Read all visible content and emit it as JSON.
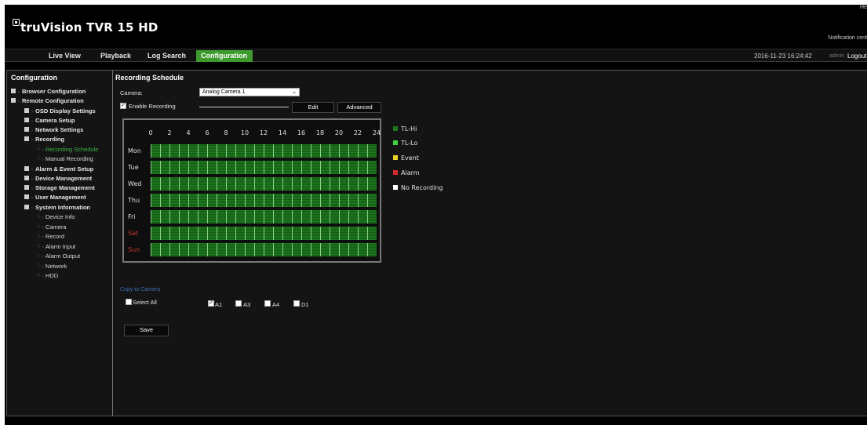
{
  "header": {
    "brand": "truVision TVR 15 HD",
    "top_right": "He",
    "notification": "Notification cent"
  },
  "nav": {
    "tabs": [
      {
        "label": "Live View",
        "active": false
      },
      {
        "label": "Playback",
        "active": false
      },
      {
        "label": "Log Search",
        "active": false
      },
      {
        "label": "Configuration",
        "active": true
      }
    ],
    "datetime": "2016-11-23 16:24:42",
    "user": "admin",
    "logout": "Logout"
  },
  "sidebar": {
    "title": "Configuration",
    "items": [
      {
        "label": "Browser Configuration"
      },
      {
        "label": "Remote Configuration"
      },
      {
        "label": "OSD Display Settings"
      },
      {
        "label": "Camera Setup"
      },
      {
        "label": "Network Settings"
      },
      {
        "label": "Recording"
      },
      {
        "label": "Recording Schedule",
        "selected": true
      },
      {
        "label": "Manual Recording"
      },
      {
        "label": "Alarm & Event Setup"
      },
      {
        "label": "Device Management"
      },
      {
        "label": "Storage Management"
      },
      {
        "label": "User Management"
      },
      {
        "label": "System Information"
      },
      {
        "label": "Device Info"
      },
      {
        "label": "Camera"
      },
      {
        "label": "Record"
      },
      {
        "label": "Alarm Input"
      },
      {
        "label": "Alarm Output"
      },
      {
        "label": "Network"
      },
      {
        "label": "HDD"
      }
    ]
  },
  "main": {
    "title": "Recording Schedule",
    "camera_label": "Camera:",
    "camera_value": "Analog Camera 1",
    "enable_recording_label": "Enable Recording",
    "enable_recording_checked": true,
    "edit_button": "Edit",
    "advanced_button": "Advanced",
    "hours": [
      "0",
      "2",
      "4",
      "6",
      "8",
      "10",
      "12",
      "14",
      "16",
      "18",
      "20",
      "22",
      "24"
    ],
    "days": [
      "Mon",
      "Tue",
      "Wed",
      "Thu",
      "Fri",
      "Sat",
      "Sun"
    ],
    "legend": [
      {
        "label": "TL-Hi",
        "color": "#1f7a1f"
      },
      {
        "label": "TL-Lo",
        "color": "#3fd13f"
      },
      {
        "label": "Event",
        "color": "#e8d12a"
      },
      {
        "label": "Alarm",
        "color": "#d12a2a"
      },
      {
        "label": "No Recording",
        "color": "#ffffff"
      }
    ],
    "copy_to_camera": "Copy to Camera",
    "select_all_label": "Select All",
    "cameras": [
      {
        "label": "A1",
        "checked": true
      },
      {
        "label": "A3",
        "checked": false
      },
      {
        "label": "A4",
        "checked": false
      },
      {
        "label": "D1",
        "checked": false
      }
    ],
    "save_button": "Save"
  }
}
